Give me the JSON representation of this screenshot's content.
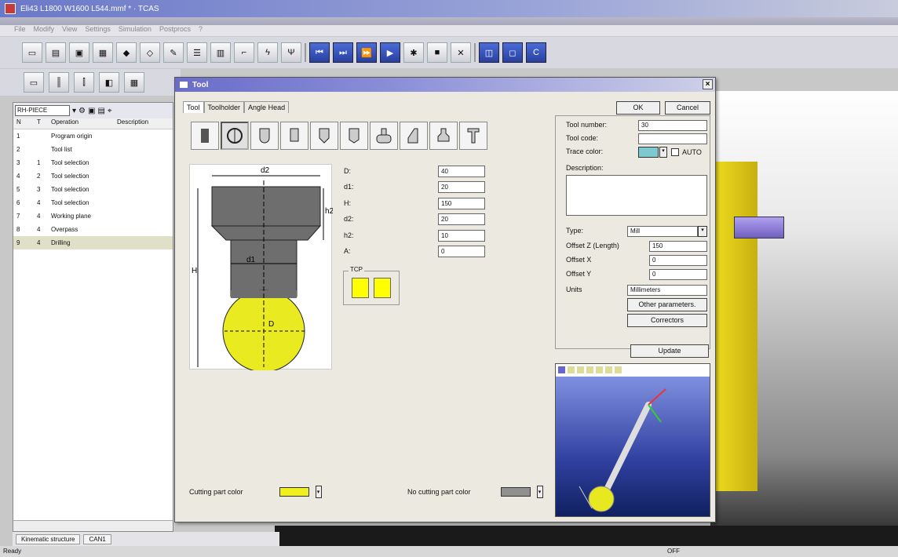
{
  "app": {
    "title": "Eli43 L1800 W1600 L544.mmf * · TCAS"
  },
  "menu": [
    "File",
    "Modify",
    "View",
    "Settings",
    "Simulation",
    "Postprocs",
    "?"
  ],
  "left_panel": {
    "workpiece_select": "RH-PIECE",
    "columns": [
      "N",
      "T",
      "Operation",
      "Description"
    ],
    "rows": [
      {
        "n": "1",
        "t": "",
        "op": "Program origin"
      },
      {
        "n": "2",
        "t": "",
        "op": "Tool list"
      },
      {
        "n": "3",
        "t": "1",
        "op": "Tool selection"
      },
      {
        "n": "4",
        "t": "2",
        "op": "Tool selection"
      },
      {
        "n": "5",
        "t": "3",
        "op": "Tool selection"
      },
      {
        "n": "6",
        "t": "4",
        "op": "Tool selection"
      },
      {
        "n": "7",
        "t": "4",
        "op": "Working plane"
      },
      {
        "n": "8",
        "t": "4",
        "op": "Overpass"
      },
      {
        "n": "9",
        "t": "4",
        "op": "Drilling"
      }
    ]
  },
  "bottom_tabs": [
    "Kinematic structure",
    "CAN1"
  ],
  "status": {
    "left": "Ready",
    "right": "OFF"
  },
  "dialog": {
    "title": "Tool",
    "tabs": [
      "Tool",
      "Toolholder",
      "Angle Head"
    ],
    "ok": "OK",
    "cancel": "Cancel",
    "drawing_labels": {
      "d2": "d2",
      "h2": "h2",
      "H": "H",
      "d1": "d1",
      "D": "D"
    },
    "params": [
      {
        "label": "D:",
        "value": "40"
      },
      {
        "label": "d1:",
        "value": "20"
      },
      {
        "label": "H:",
        "value": "150"
      },
      {
        "label": "d2:",
        "value": "20"
      },
      {
        "label": "h2:",
        "value": "10"
      },
      {
        "label": "A:",
        "value": "0"
      }
    ],
    "tcp_label": "TCP",
    "cutting_color_label": "Cutting part color",
    "no_cutting_color_label": "No cutting part color",
    "cutting_color": "#f0f020",
    "no_cutting_color": "#909090",
    "right": {
      "tool_number_label": "Tool number:",
      "tool_number": "30",
      "tool_code_label": "Tool code:",
      "tool_code": "",
      "trace_color_label": "Trace color:",
      "auto_label": "AUTO",
      "description_label": "Description:",
      "type_label": "Type:",
      "type_value": "Mill",
      "offset_z_label": "Offset Z (Length)",
      "offset_z": "150",
      "offset_x_label": "Offset X",
      "offset_x": "0",
      "offset_y_label": "Offset Y",
      "offset_y": "0",
      "units_label": "Units",
      "units_value": "Millimeters",
      "other_params": "Other parameters.",
      "correctors": "Correctors",
      "update": "Update"
    }
  }
}
